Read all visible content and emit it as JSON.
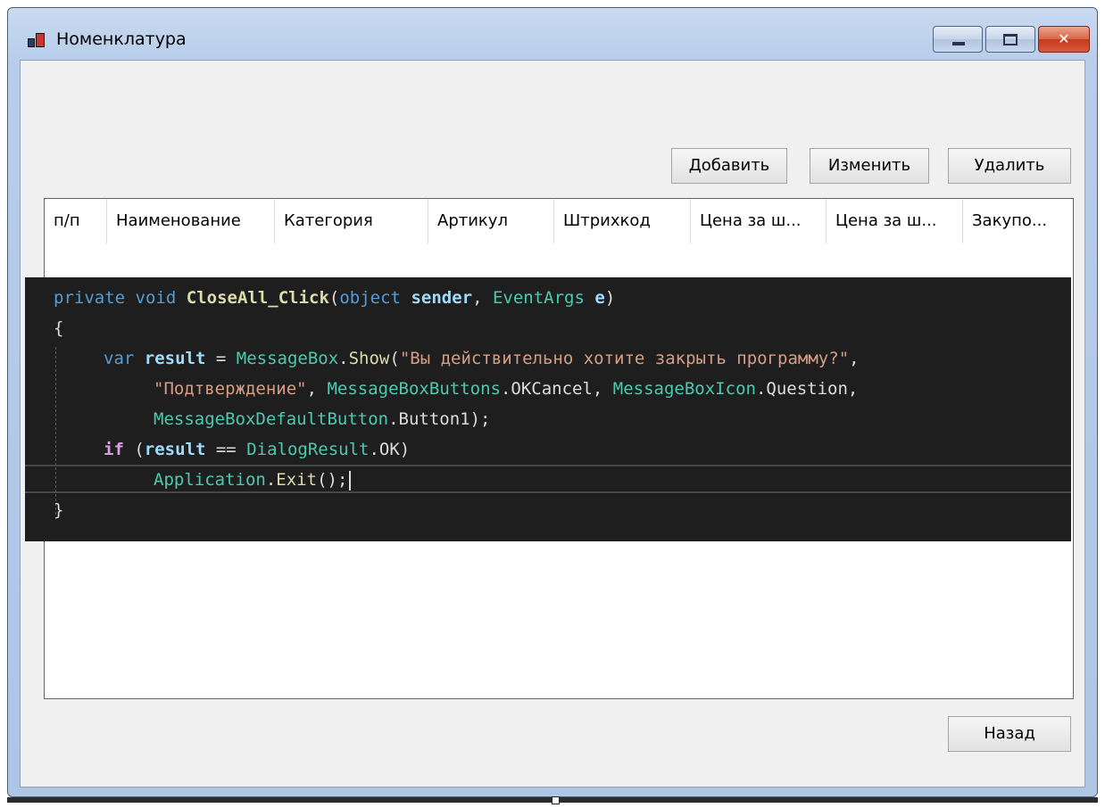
{
  "window": {
    "title": "Номенклатура",
    "icon": "app-window-icon",
    "caption_buttons": [
      "minimize-icon",
      "maximize-icon",
      "close-icon"
    ]
  },
  "toolbar": {
    "add_label": "Добавить",
    "edit_label": "Изменить",
    "delete_label": "Удалить"
  },
  "grid": {
    "columns": [
      "п/п",
      "Наименование",
      "Категория",
      "Артикул",
      "Штрихкод",
      "Цена за ш...",
      "Цена за ш...",
      "Закупо..."
    ],
    "rows": []
  },
  "code": {
    "l1": {
      "a": "private",
      "b": "void",
      "c": "CloseAll_Click",
      "d": "(",
      "e": "object",
      "f": "sender",
      "g": ", ",
      "h": "EventArgs",
      "i": "e",
      "j": ")"
    },
    "l2": "{",
    "l3": {
      "a": "var",
      "b": "result",
      "c": " = ",
      "d": "MessageBox",
      "e": ".",
      "f": "Show",
      "g": "(",
      "h": "\"Вы действительно хотите закрыть программу?\"",
      "i": ","
    },
    "l4": {
      "a": "\"Подтверждение\"",
      "b": ", ",
      "c": "MessageBoxButtons",
      "d": ".OKCancel, ",
      "e": "MessageBoxIcon",
      "f": ".Question,"
    },
    "l5": {
      "a": "MessageBoxDefaultButton",
      "b": ".Button1);"
    },
    "l6": {
      "a": "if",
      "b": " (",
      "c": "result",
      "d": " == ",
      "e": "DialogResult",
      "f": ".OK)"
    },
    "l7": {
      "a": "Application",
      "b": ".",
      "c": "Exit",
      "d": "();"
    },
    "l8": "}"
  },
  "footer": {
    "back_label": "Назад"
  },
  "colors": {
    "code_bg": "#1e1e1e",
    "keyword": "#569cd6",
    "type": "#4ec9b0",
    "string": "#d69d85",
    "method": "#dcdcaa",
    "control_keyword": "#d8a0df"
  }
}
